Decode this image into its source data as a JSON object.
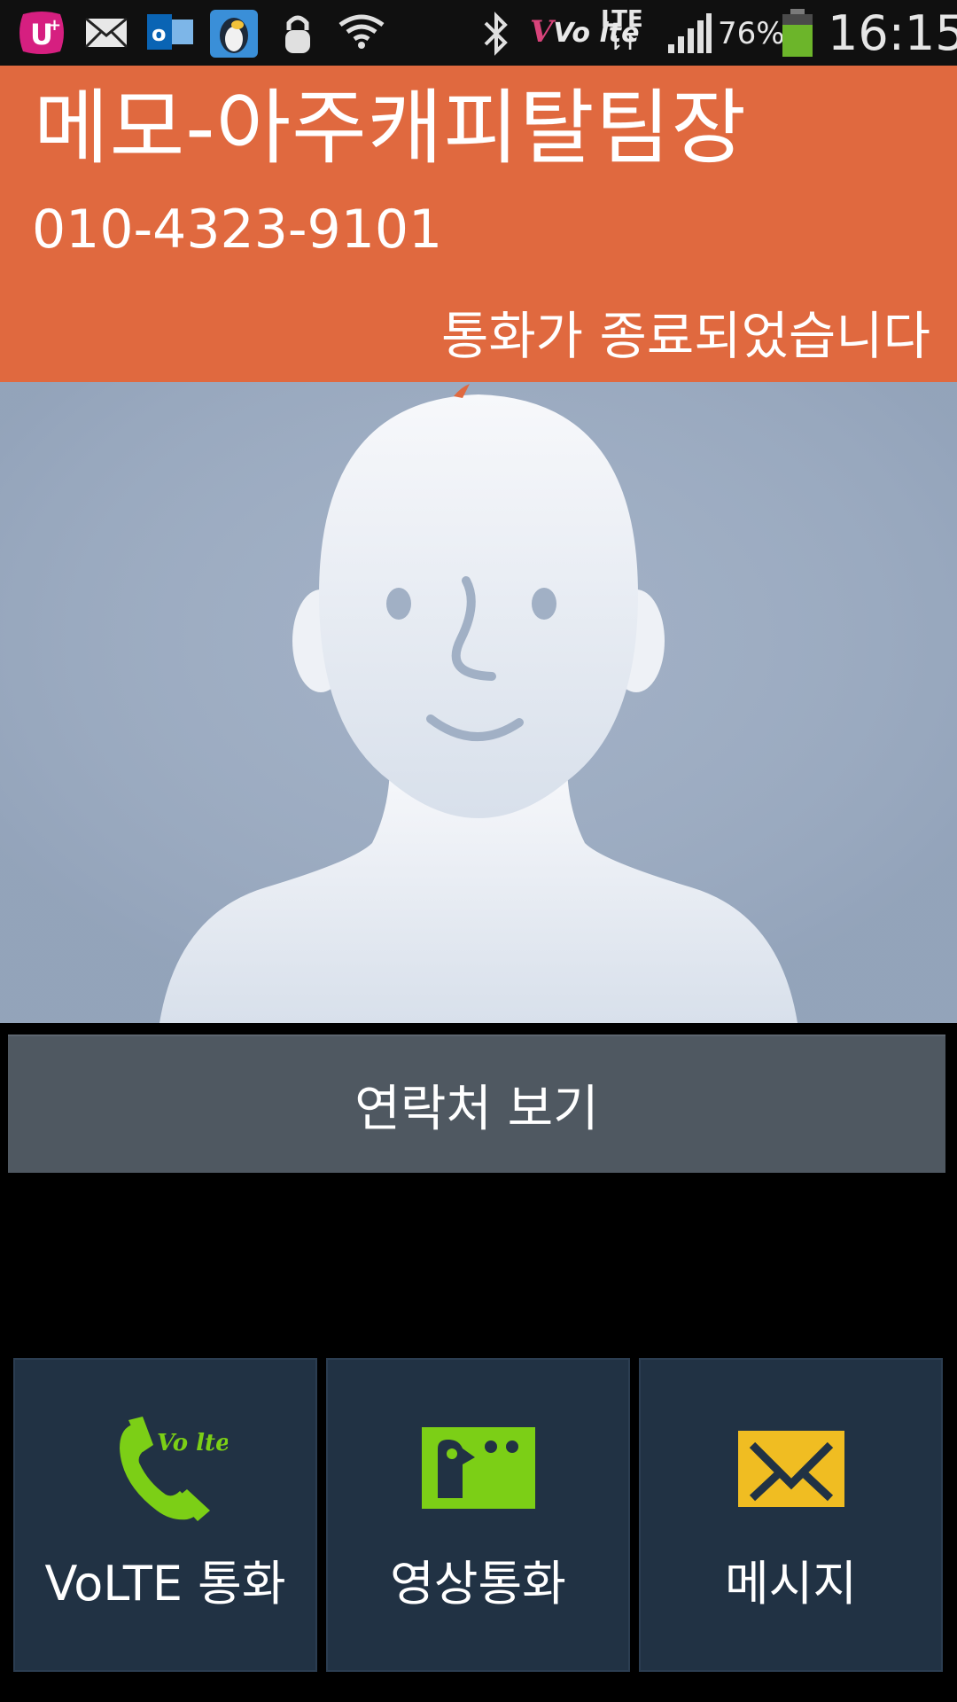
{
  "status_bar": {
    "battery_percent": "76%",
    "time": "16:15",
    "network_label": "LTE",
    "volte_label": "Vo lte",
    "app_icons": [
      "u-plus-icon",
      "mail-icon",
      "outlook-icon",
      "penguin-game-icon",
      "lock-icon",
      "wifi-icon"
    ],
    "system_icons": [
      "bluetooth-icon",
      "volte-icon",
      "lte-icon",
      "signal-icon",
      "battery-icon"
    ]
  },
  "caller": {
    "name": "메모-아주캐피탈팀장",
    "number": "010-4323-9101",
    "status": "통화가 종료되었습니다"
  },
  "contact_photo": {
    "type": "default-avatar",
    "background": "#a1b0c5"
  },
  "view_contact": {
    "label": "연락처 보기"
  },
  "actions": [
    {
      "label": "VoLTE 통화",
      "icon": "volte-call-icon",
      "icon_text": "Vo lte"
    },
    {
      "label": "영상통화",
      "icon": "video-call-icon"
    },
    {
      "label": "메시지",
      "icon": "message-icon"
    }
  ],
  "colors": {
    "header": "#e0693f",
    "action_bg": "#213244",
    "green": "#7ccf16",
    "yellow": "#f0bd22"
  }
}
